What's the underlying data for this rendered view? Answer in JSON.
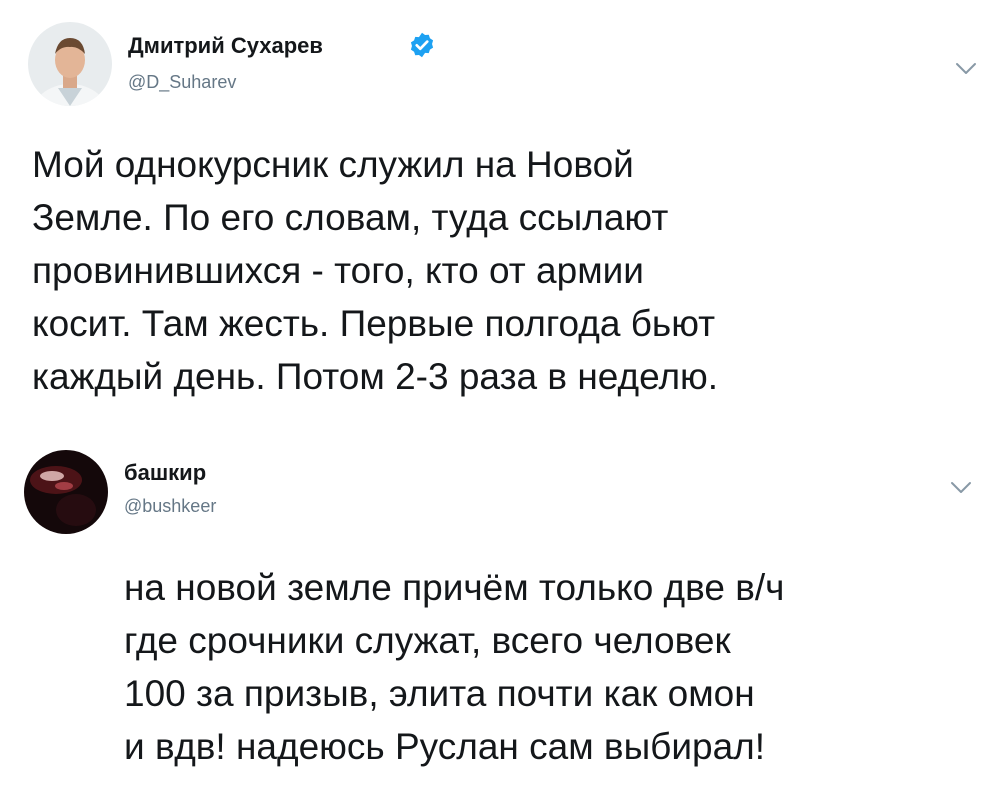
{
  "tweet1": {
    "author_name": "Дмитрий Сухарев",
    "handle": "@D_Suharev",
    "verified": true,
    "text": "Мой однокурсник служил на Новой\nЗемле. По его словам, туда ссылают\nпровинившихся - того, кто от армии\nкосит. Там жесть. Первые полгода бьют\nкаждый день. Потом 2-3 раза в неделю."
  },
  "tweet2": {
    "author_name": "башкир",
    "handle": "@bushkeer",
    "text": "на новой земле причём только две в/ч\nгде срочники служат, всего человек\n100 за призыв, элита почти как омон\nи вдв! надеюсь Руслан сам выбирал!"
  },
  "icons": {
    "verified": "verified-badge-icon",
    "menu": "chevron-down-icon"
  },
  "colors": {
    "text": "#14171a",
    "secondary": "#657786",
    "verified": "#1da1f2"
  }
}
